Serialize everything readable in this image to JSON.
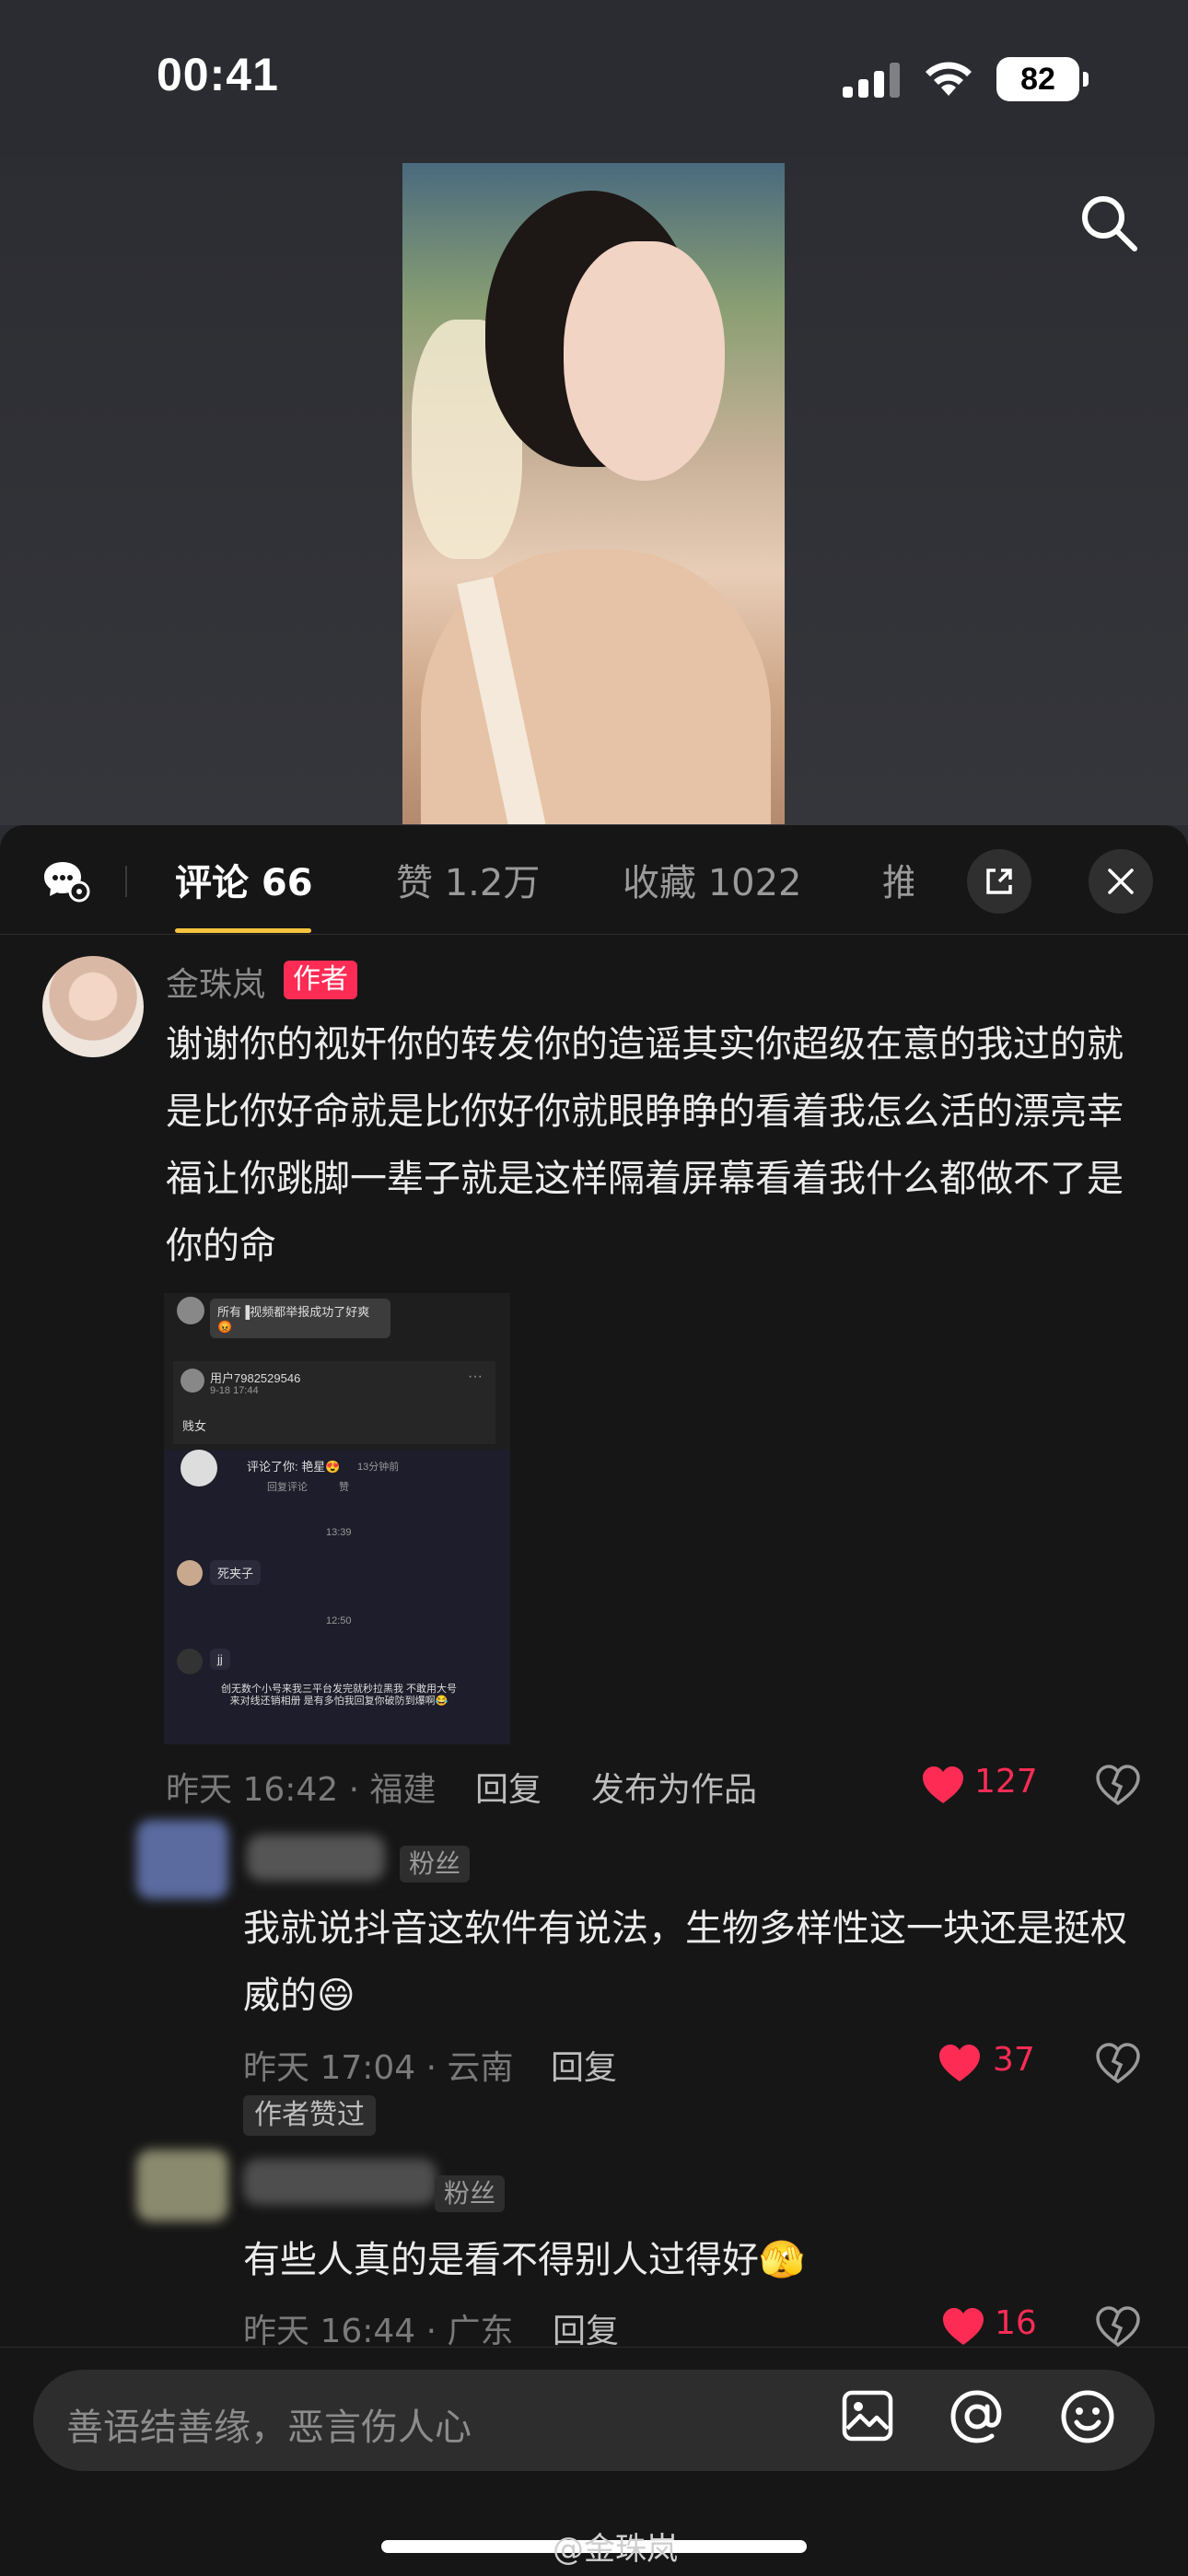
{
  "status": {
    "time": "00:41",
    "battery": "82"
  },
  "tabs": [
    {
      "label": "评论 66"
    },
    {
      "label": "赞 1.2万"
    },
    {
      "label": "收藏 1022"
    },
    {
      "label": "推"
    }
  ],
  "comments": [
    {
      "name": "金珠岚",
      "tag": "作者",
      "text": "谢谢你的视奸你的转发你的造谣其实你超级在意的我过的就是比你好命就是比你好你就眼睁睁的看着我怎么活的漂亮幸福让你跳脚一辈子就是这样隔着屏幕看着我什么都做不了是你的命",
      "meta": "昨天 16:42 · 福建",
      "reply": "回复",
      "publish": "发布为作品",
      "likes": "127"
    },
    {
      "tag": "粉丝",
      "text": "我就说抖音这软件有说法，生物多样性这一块还是挺权威的😄",
      "meta": "昨天 17:04 · 云南",
      "reply": "回复",
      "likes": "37",
      "author_liked": "作者赞过"
    },
    {
      "tag": "粉丝",
      "text": "有些人真的是看不得别人过得好🫣",
      "meta": "昨天 16:44 · 广东",
      "reply": "回复",
      "likes": "16"
    }
  ],
  "screenshot": {
    "msg1": "所有▐视频都举报成功了好爽😡",
    "user": "用户7982529546",
    "date": "9-18 17:44",
    "word": "贱女",
    "notify": "评论了你: 艳星😍",
    "ago": "13分钟前",
    "reply_btn": "回复评论",
    "like_btn": "赞",
    "t1": "13:39",
    "m2": "死夹子",
    "t2": "12:50",
    "m3": "jj",
    "caption": "创无数个小号来我三平台发完就秒拉黑我 不敢用大号来对线还销相册 是有多怕我回复你破防到爆啊😂"
  },
  "input": {
    "placeholder": "善语结善缘，恶言伤人心"
  },
  "watermark": "@金珠岚",
  "colors": {
    "accent": "#fe2c55",
    "tab_underline": "#f5c43c",
    "panel": "#161616"
  }
}
